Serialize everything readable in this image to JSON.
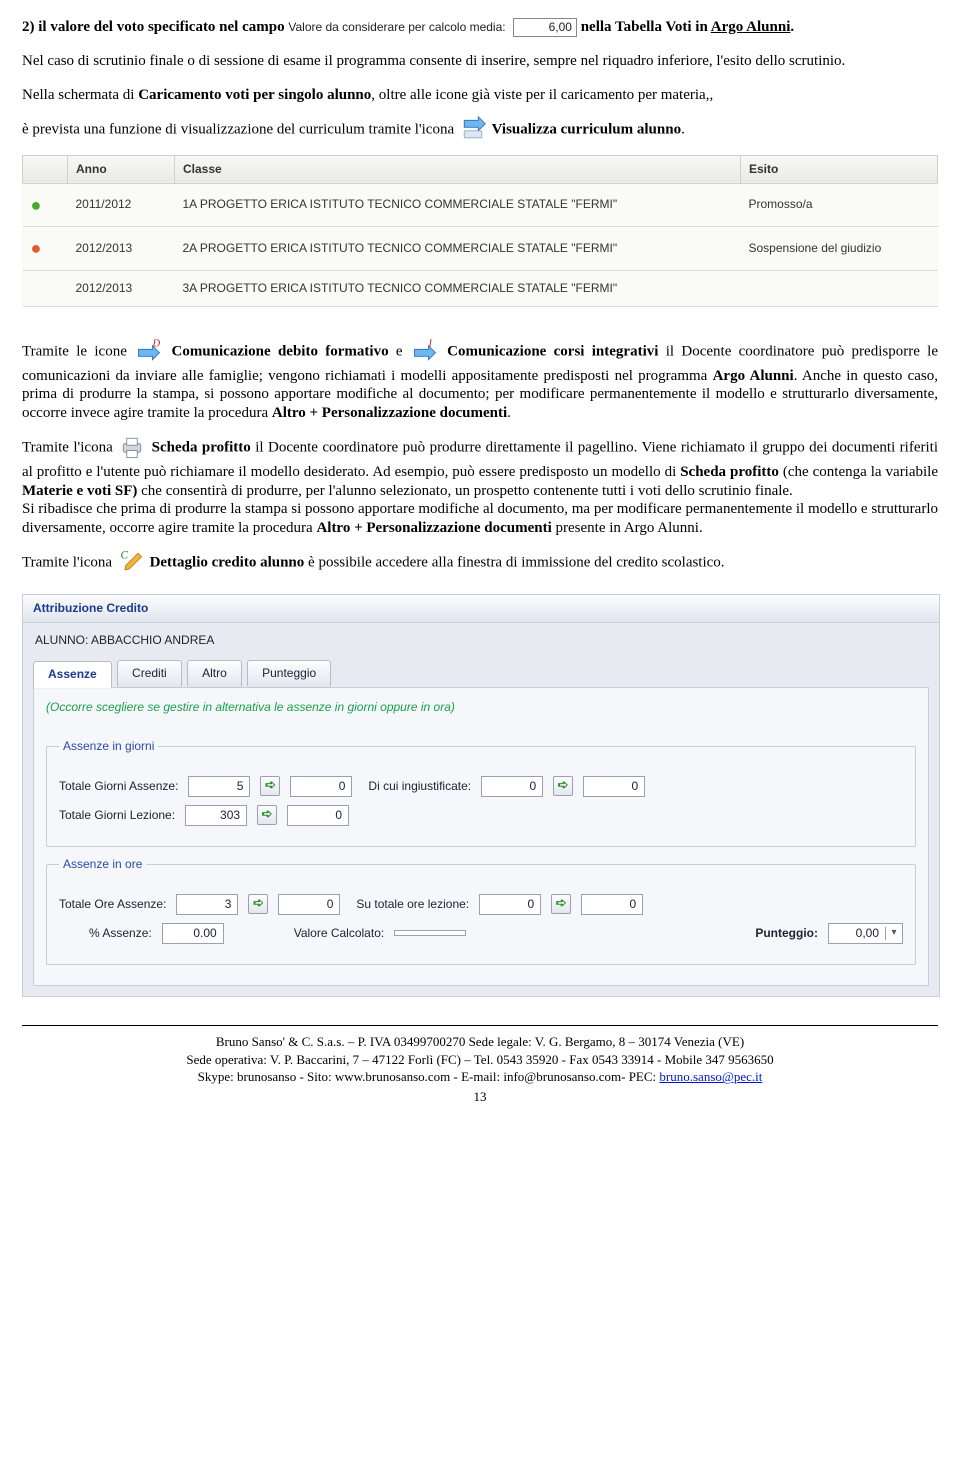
{
  "top": {
    "line1_prefix": "2) il valore del voto specificato nel campo ",
    "valore_label": "Valore da considerare per calcolo media:",
    "valore_value": "6,00",
    "line1_suffix": " nella Tabella Voti in ",
    "argo": "Argo Alunni",
    "period": "."
  },
  "para1": "Nel caso di scrutinio finale o di sessione di esame il programma consente di inserire, sempre nel riquadro inferiore, l'esito dello scrutinio.",
  "para2_a": "Nella schermata di ",
  "para2_b": "Caricamento voti per singolo alunno",
  "para2_c": ", oltre alle icone già viste per il caricamento per materia,,",
  "para3_a": "è prevista una funzione di visualizzazione del curriculum tramite l'icona ",
  "para3_b": "Visualizza curriculum alunno",
  "para3_c": ".",
  "curriculum": {
    "headers": {
      "status": "",
      "anno": "Anno",
      "classe": "Classe",
      "esito": "Esito"
    },
    "rows": [
      {
        "status": "green",
        "anno": "2011/2012",
        "classe": "1A PROGETTO ERICA ISTITUTO TECNICO COMMERCIALE STATALE \"FERMI\"",
        "esito": "Promosso/a"
      },
      {
        "status": "orange",
        "anno": "2012/2013",
        "classe": "2A PROGETTO ERICA ISTITUTO TECNICO COMMERCIALE STATALE \"FERMI\"",
        "esito": "Sospensione del giudizio"
      },
      {
        "status": "",
        "anno": "2012/2013",
        "classe": "3A PROGETTO ERICA ISTITUTO TECNICO COMMERCIALE STATALE \"FERMI\"",
        "esito": ""
      }
    ]
  },
  "para4_a": "Tramite le icone ",
  "para4_b": "Comunicazione debito formativo",
  "para4_c": " e ",
  "para4_d": "Comunicazione corsi integrativi",
  "para4_e": " il Docente coordinatore può predisporre le comunicazioni da inviare alle famiglie; vengono richiamati i modelli appositamente predisposti nel programma ",
  "para4_f": "Argo Alunni",
  "para4_g": ". Anche in questo caso, prima di produrre la stampa, si possono apportare modifiche al documento; per modificare permanentemente il modello e strutturarlo diversamente, occorre invece agire tramite la procedura ",
  "para4_h": "Altro + Personalizzazione documenti",
  "para4_i": ".",
  "para5_a": "Tramite l'icona ",
  "para5_b": "Scheda profitto",
  "para5_c": " il Docente coordinatore può produrre direttamente il pagellino. Viene richiamato il gruppo dei documenti riferiti al profitto e l'utente può richiamare il modello desiderato. Ad esempio, può essere predisposto un modello di ",
  "para5_d": "Scheda profitto ",
  "para5_e": "(che contenga la variabile ",
  "para5_f": "Materie e voti SF) ",
  "para5_g": "che consentirà di produrre, per l'alunno selezionato, un prospetto contenente tutti i voti dello scrutinio finale.",
  "para6_a": "Si ribadisce che prima di produrre la stampa si possono apportare modifiche al documento, ma per modificare permanentemente il modello e strutturarlo diversamente, occorre agire tramite la procedura ",
  "para6_b": "Altro + Personalizzazione documenti",
  "para6_c": " presente in Argo Alunni.",
  "para7_a": "Tramite l'icona ",
  "para7_b": "Dettaglio credito alunno",
  "para7_c": " è possibile accedere alla finestra di immissione del credito scolastico.",
  "credit": {
    "title": "Attribuzione Credito",
    "student": "ALUNNO: ABBACCHIO ANDREA",
    "tabs": [
      "Assenze",
      "Crediti",
      "Altro",
      "Punteggio"
    ],
    "hint": "(Occorre scegliere se gestire in alternativa le assenze in giorni oppure in ora)",
    "giorni": {
      "legend": "Assenze in giorni",
      "tot_giorni_ass_label": "Totale Giorni Assenze:",
      "tot_giorni_ass_a": "5",
      "tot_giorni_ass_b": "0",
      "ingiust_label": "Di cui ingiustificate:",
      "ingiust_a": "0",
      "ingiust_b": "0",
      "tot_giorni_lez_label": "Totale Giorni Lezione:",
      "tot_giorni_lez_a": "303",
      "tot_giorni_lez_b": "0"
    },
    "ore": {
      "legend": "Assenze in ore",
      "tot_ore_ass_label": "Totale Ore Assenze:",
      "tot_ore_ass_a": "3",
      "tot_ore_ass_b": "0",
      "tot_ore_lez_label": "Su totale ore lezione:",
      "tot_ore_lez_a": "0",
      "tot_ore_lez_b": "0",
      "perc_label": "% Assenze:",
      "perc_val": "0.00",
      "valcalc_label": "Valore Calcolato:",
      "valcalc_val": "",
      "punteggio_label": "Punteggio:",
      "punteggio_val": "0,00"
    }
  },
  "footer": {
    "l1": "Bruno Sanso' & C. S.a.s. – P. IVA 03499700270 Sede legale: V. G. Bergamo, 8 – 30174 Venezia (VE)",
    "l2": "Sede operativa: V. P. Baccarini, 7 – 47122 Forlì (FC) – Tel. 0543 35920 - Fax 0543 33914 - Mobile 347 9563650",
    "l3a": "Skype: brunosanso  - Sito: www.brunosanso.com - E-mail: info@brunosanso.com- PEC: ",
    "l3link": "bruno.sanso@pec.it",
    "page": "13"
  }
}
